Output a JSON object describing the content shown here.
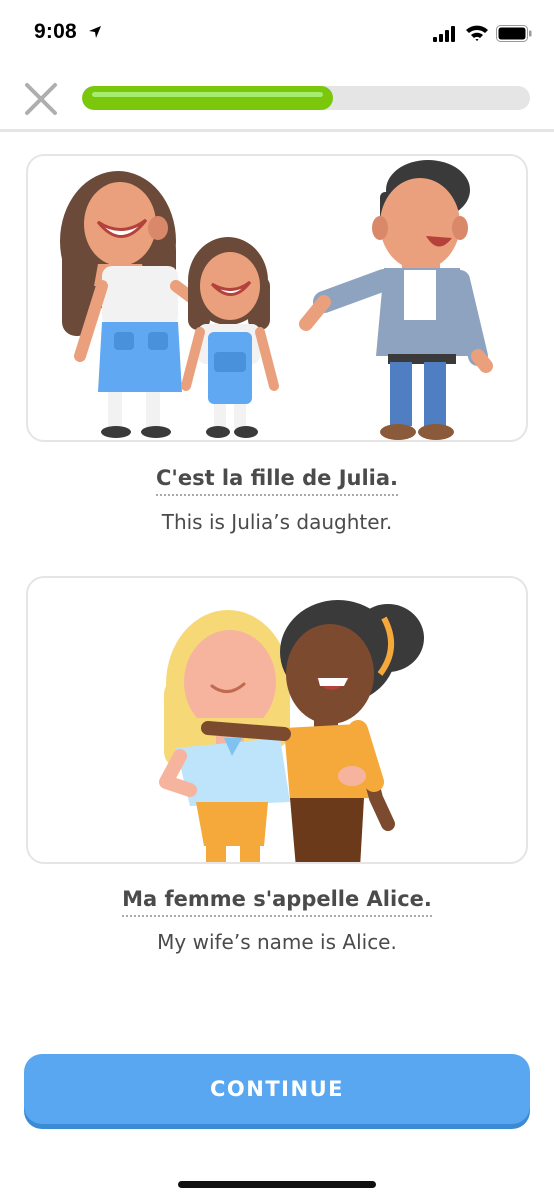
{
  "status_bar": {
    "time": "9:08",
    "icons": [
      "location-arrow-icon",
      "cellular-signal-icon",
      "wifi-icon",
      "battery-icon"
    ]
  },
  "lesson": {
    "close_icon": "close-icon",
    "progress_fraction": 0.56,
    "progress_color": "#7ac70c"
  },
  "cards": [
    {
      "illustration": "woman, girl and man family illustration",
      "phrase_fr": "C'est la fille de Julia.",
      "phrase_en": "This is Julia’s daughter."
    },
    {
      "illustration": "two women embracing illustration",
      "phrase_fr": "Ma femme s'appelle Alice.",
      "phrase_en": "My wife’s name is Alice."
    }
  ],
  "continue_button": {
    "label": "CONTINUE",
    "color": "#58a7f0"
  }
}
